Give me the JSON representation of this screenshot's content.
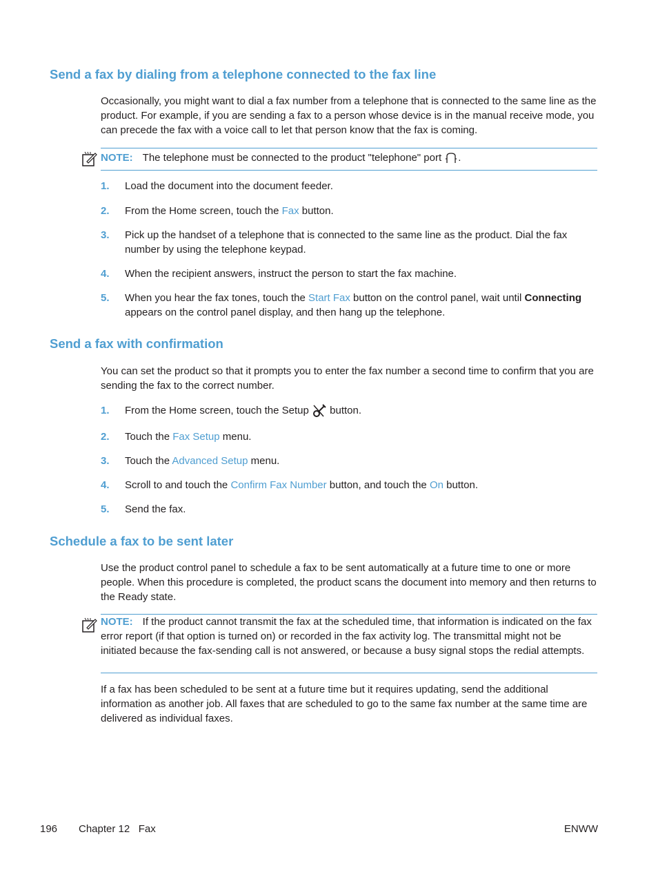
{
  "section1": {
    "heading": "Send a fax by dialing from a telephone connected to the fax line",
    "intro": "Occasionally, you might want to dial a fax number from a telephone that is connected to the same line as the product. For example, if you are sending a fax to a person whose device is in the manual receive mode, you can precede the fax with a voice call to let that person know that the fax is coming.",
    "note": {
      "label": "NOTE:",
      "text": "The telephone must be connected to the product \"telephone\" port",
      "end": ".",
      "icon": "telephone-port-icon"
    },
    "steps": [
      {
        "num": "1.",
        "pre": "Load the document into the document feeder."
      },
      {
        "num": "2.",
        "pre": "From the Home screen, touch the ",
        "link": "Fax",
        "post": " button."
      },
      {
        "num": "3.",
        "pre": "Pick up the handset of a telephone that is connected to the same line as the product. Dial the fax number by using the telephone keypad."
      },
      {
        "num": "4.",
        "pre": "When the recipient answers, instruct the person to start the fax machine."
      },
      {
        "num": "5.",
        "pre": "When you hear the fax tones, touch the ",
        "link": "Start Fax",
        "post": " button on the control panel, wait until ",
        "bold": "Connecting",
        "post2": " appears on the control panel display, and then hang up the telephone."
      }
    ]
  },
  "section2": {
    "heading": "Send a fax with confirmation",
    "intro": "You can set the product so that it prompts you to enter the fax number a second time to confirm that you are sending the fax to the correct number.",
    "steps": [
      {
        "num": "1.",
        "pre": "From the Home screen, touch the Setup ",
        "post": " button.",
        "icon": "setup-icon"
      },
      {
        "num": "2.",
        "pre": "Touch the ",
        "link": "Fax Setup",
        "post": " menu."
      },
      {
        "num": "3.",
        "pre": "Touch the ",
        "link": "Advanced Setup",
        "post": " menu."
      },
      {
        "num": "4.",
        "pre": "Scroll to and touch the ",
        "link": "Confirm Fax Number",
        "post": " button, and touch the ",
        "link2": "On",
        "post2": " button."
      },
      {
        "num": "5.",
        "pre": "Send the fax."
      }
    ]
  },
  "section3": {
    "heading": "Schedule a fax to be sent later",
    "intro": "Use the product control panel to schedule a fax to be sent automatically at a future time to one or more people. When this procedure is completed, the product scans the document into memory and then returns to the Ready state.",
    "note": {
      "label": "NOTE:",
      "text": "If the product cannot transmit the fax at the scheduled time, that information is indicated on the fax error report (if that option is turned on) or recorded in the fax activity log. The transmittal might not be initiated because the fax-sending call is not answered, or because a busy signal stops the redial attempts."
    },
    "outro": "If a fax has been scheduled to be sent at a future time but it requires updating, send the additional information as another job. All faxes that are scheduled to go to the same fax number at the same time are delivered as individual faxes."
  },
  "footer": {
    "page": "196",
    "chapter": "Chapter 12   Fax",
    "code": "ENWW"
  }
}
